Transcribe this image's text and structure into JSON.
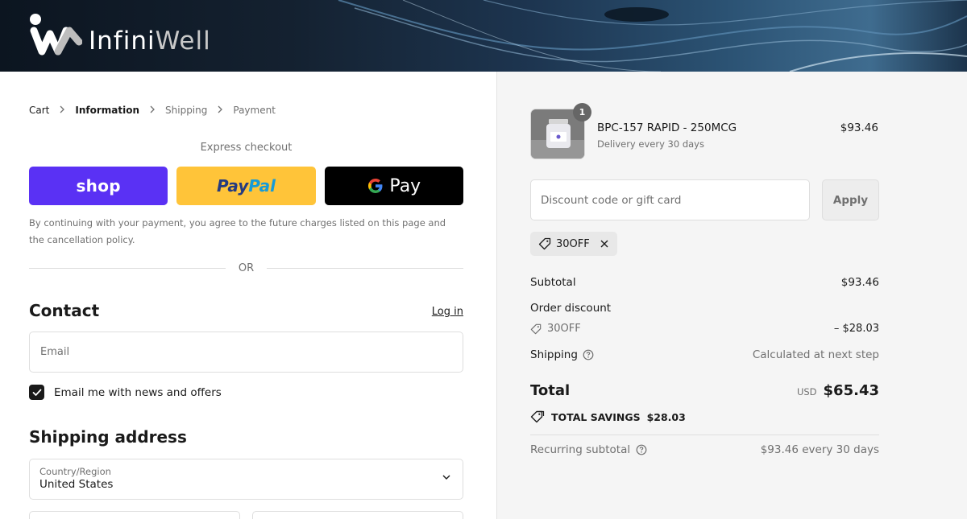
{
  "header": {
    "brand_part1": "Infini",
    "brand_part2": "Well"
  },
  "breadcrumb": {
    "items": [
      "Cart",
      "Information",
      "Shipping",
      "Payment"
    ],
    "active": "Information"
  },
  "express": {
    "title": "Express checkout",
    "shop_label": "shop",
    "paypal_part1": "Pay",
    "paypal_part2": "Pal",
    "gpay_g": "G",
    "gpay_label": "Pay"
  },
  "legal_text": "By continuing with your payment, you agree to the future charges listed on this page and the cancellation policy.",
  "or_label": "OR",
  "contact": {
    "title": "Contact",
    "login_label": "Log in",
    "email_placeholder": "Email",
    "newsletter_label": "Email me with news and offers",
    "newsletter_checked": true
  },
  "shipping_address": {
    "title": "Shipping address",
    "country_label": "Country/Region",
    "country_value": "United States"
  },
  "order": {
    "product": {
      "name": "BPC-157 RAPID - 250MCG",
      "subtitle": "Delivery every 30 days",
      "price": "$93.46",
      "quantity": "1"
    },
    "discount_placeholder": "Discount code or gift card",
    "apply_label": "Apply",
    "applied_code": "30OFF",
    "subtotal_label": "Subtotal",
    "subtotal_value": "$93.46",
    "order_discount_label": "Order discount",
    "order_discount_code": "30OFF",
    "order_discount_value": "– $28.03",
    "shipping_label": "Shipping",
    "shipping_value": "Calculated at next step",
    "total_label": "Total",
    "total_currency": "USD",
    "total_value": "$65.43",
    "savings_label": "TOTAL SAVINGS",
    "savings_value": "$28.03",
    "recurring_label": "Recurring subtotal",
    "recurring_value": "$93.46 every 30 days"
  },
  "colors": {
    "shop_purple": "#5a31f4",
    "paypal_yellow": "#ffc439",
    "gpay_black": "#000000",
    "summary_bg": "#f5f5f5"
  },
  "icons": [
    "chevron-right-icon",
    "checkmark-icon",
    "chevron-down-icon",
    "tag-icon",
    "close-icon",
    "help-circle-icon",
    "savings-tag-icon"
  ]
}
